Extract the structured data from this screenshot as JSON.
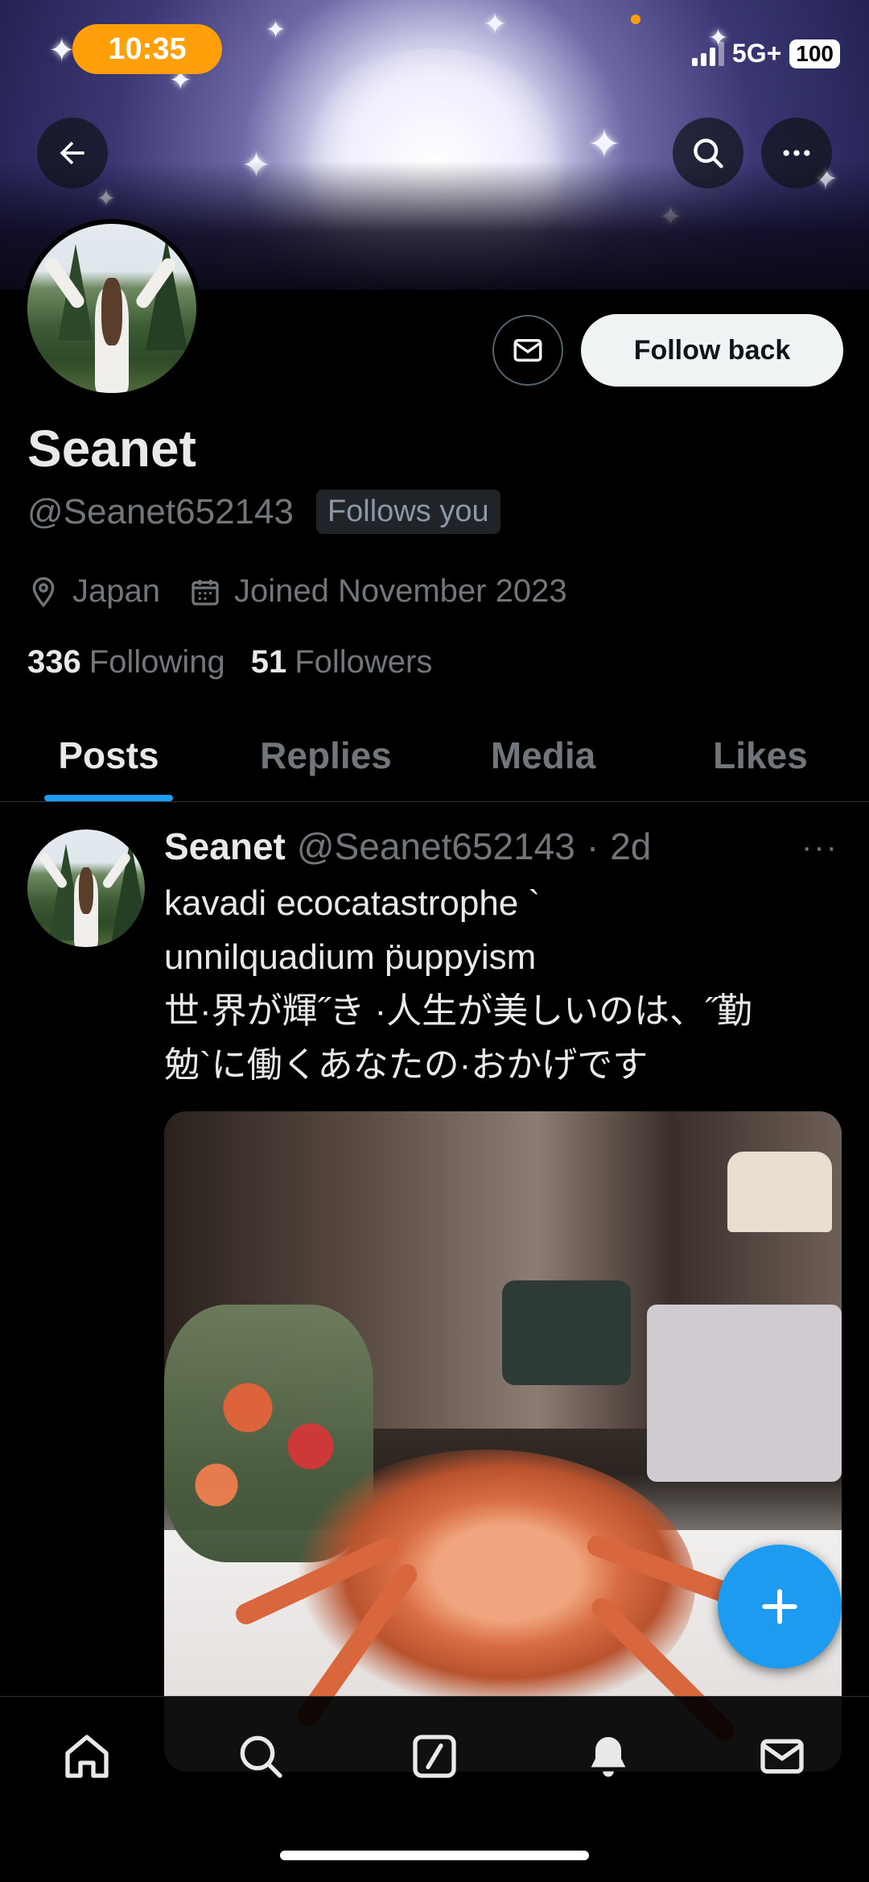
{
  "status_bar": {
    "time": "10:35",
    "network": "5G+",
    "battery": "100"
  },
  "header": {
    "back_icon": "arrow-left-icon",
    "search_icon": "search-icon",
    "more_icon": "more-horizontal-icon"
  },
  "profile": {
    "display_name": "Seanet",
    "handle": "@Seanet652143",
    "follows_you": "Follows you",
    "location": "Japan",
    "joined": "Joined November 2023",
    "following_count": "336",
    "following_label": "Following",
    "followers_count": "51",
    "followers_label": "Followers",
    "message_icon": "envelope-icon",
    "follow_button": "Follow back"
  },
  "tabs": [
    {
      "label": "Posts",
      "active": true
    },
    {
      "label": "Replies",
      "active": false
    },
    {
      "label": "Media",
      "active": false
    },
    {
      "label": "Likes",
      "active": false
    }
  ],
  "post": {
    "name": "Seanet",
    "handle": "@Seanet652143",
    "separator": "·",
    "time": "2d",
    "more": "···",
    "text": "kavadi ecocatastrophe `\nunnilquadium p̈uppyism\n世·界が輝˝き ·人生が美しいのは、˝勤\n勉`に働くあなたの·おかげです"
  },
  "fab": {
    "icon": "plus-icon"
  },
  "bottom_nav": [
    {
      "icon": "home-icon"
    },
    {
      "icon": "search-icon"
    },
    {
      "icon": "compose-grok-icon"
    },
    {
      "icon": "bell-icon"
    },
    {
      "icon": "envelope-icon"
    }
  ],
  "colors": {
    "accent": "#1d9bf0",
    "status_pill": "#ff9f0a",
    "background": "#000000",
    "muted": "#71767b"
  }
}
